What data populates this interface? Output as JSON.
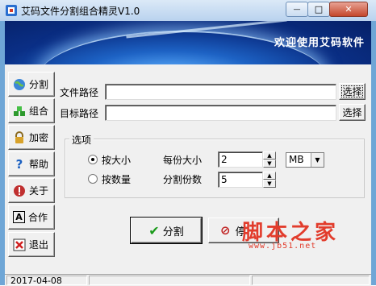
{
  "window": {
    "title": "艾码文件分割组合精灵V1.0",
    "close_glyph": "✕",
    "min_glyph": "—",
    "max_glyph": "□"
  },
  "banner": {
    "text": "欢迎使用艾码软件"
  },
  "sidebar": {
    "items": [
      {
        "label": "分割",
        "icon": "globe-icon"
      },
      {
        "label": "组合",
        "icon": "blocks-icon"
      },
      {
        "label": "加密",
        "icon": "lock-icon"
      },
      {
        "label": "帮助",
        "icon": "question-icon"
      },
      {
        "label": "关于",
        "icon": "info-icon"
      },
      {
        "label": "合作",
        "icon": "letter-a-icon"
      },
      {
        "label": "退出",
        "icon": "exit-icon"
      }
    ]
  },
  "paths": {
    "source_label": "文件路径",
    "source_value": "",
    "source_button": "选择",
    "target_label": "目标路径",
    "target_value": "",
    "target_button": "选择"
  },
  "options": {
    "group_title": "选项",
    "by_size_label": "按大小",
    "by_count_label": "按数量",
    "size_label": "每份大小",
    "count_label": "分割份数",
    "size_value": "2",
    "count_value": "5",
    "unit_value": "MB",
    "selected_mode": "by_size"
  },
  "actions": {
    "split_label": "分割",
    "stop_label": "停"
  },
  "watermark": {
    "main": "脚本之家",
    "sub": "www.jb51.net"
  },
  "status": {
    "date": "2017-04-08"
  },
  "colors": {
    "accent_banner": "#0a2f86",
    "watermark": "#e23c2c",
    "check_green": "#1a9a1a"
  }
}
